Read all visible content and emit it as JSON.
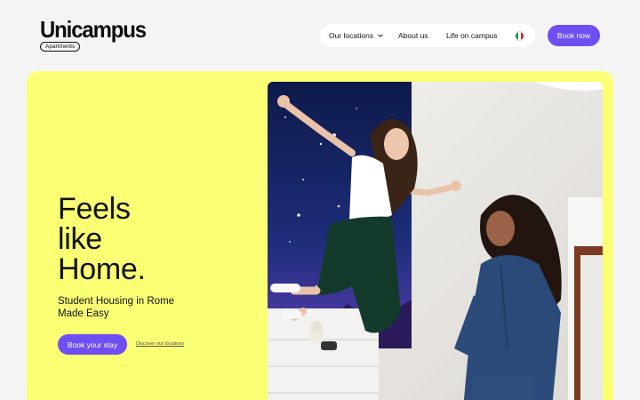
{
  "brand": {
    "name": "Unicampus",
    "badge": "Apartments"
  },
  "nav": {
    "items": [
      {
        "label": "Our locations",
        "has_dropdown": true
      },
      {
        "label": "About us"
      },
      {
        "label": "Life on campus"
      }
    ],
    "language_flag": "italy-flag-icon"
  },
  "header": {
    "cta_label": "Book now"
  },
  "hero": {
    "title_lines": [
      "Feels",
      "like",
      "Home."
    ],
    "subtitle": "Student Housing in Rome Made Easy",
    "primary_cta": "Book your stay",
    "secondary_link": "Discover our locations",
    "image": "two-young-women-jumping-in-room-photo"
  },
  "colors": {
    "accent": "#6f4ef2",
    "hero_background": "#fbff73",
    "page_background": "#f4f4f4"
  }
}
